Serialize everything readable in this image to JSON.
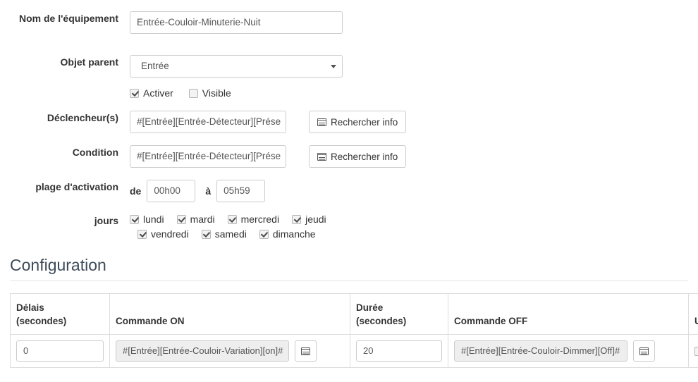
{
  "form": {
    "rows": [
      {
        "label": "Nom de l'équipement",
        "type": "text",
        "value": "Entrée-Couloir-Minuterie-Nuit"
      },
      {
        "label": "Objet parent",
        "type": "select",
        "value": "Entrée"
      },
      {
        "label": "Déclencheur(s)",
        "type": "expr",
        "value": "#[Entrée][Entrée-Détecteur][Prése"
      },
      {
        "label": "Condition",
        "type": "expr",
        "value": "#[Entrée][Entrée-Détecteur][Prése"
      },
      {
        "label": "plage d'activation",
        "type": "range"
      },
      {
        "label": "jours",
        "type": "days"
      }
    ],
    "name_label": "Nom de l'équipement",
    "name_value": "Entrée-Couloir-Minuterie-Nuit",
    "parent_label": "Objet parent",
    "parent_value": "Entrée",
    "trigger_label": "Déclencheur(s)",
    "trigger_value": "#[Entrée][Entrée-Détecteur][Prése",
    "condition_label": "Condition",
    "condition_value": "#[Entrée][Entrée-Détecteur][Prése",
    "search_info_label": "Rechercher info",
    "toggles": [
      {
        "label": "Activer",
        "checked": true
      },
      {
        "label": "Visible",
        "checked": false
      }
    ],
    "activer_label": "Activer",
    "visible_label": "Visible",
    "range_label": "plage d'activation",
    "range_from_prefix": "de",
    "range_from_value": "00h00",
    "range_to_prefix": "à",
    "range_to_value": "05h59",
    "days_label": "jours",
    "days": [
      {
        "label": "lundi",
        "checked": true
      },
      {
        "label": "mardi",
        "checked": true
      },
      {
        "label": "mercredi",
        "checked": true
      },
      {
        "label": "jeudi",
        "checked": true
      },
      {
        "label": "vendredi",
        "checked": true
      },
      {
        "label": "samedi",
        "checked": true
      },
      {
        "label": "dimanche",
        "checked": true
      }
    ],
    "days_row1": [
      "lundi",
      "mardi",
      "mercredi",
      "jeudi"
    ],
    "days_row2": [
      "vendredi",
      "samedi",
      "dimanche"
    ]
  },
  "configuration": {
    "title": "Configuration",
    "columns": [
      "Délais (secondes)",
      "Commande ON",
      "Durée (secondes)",
      "Commande OFF",
      "Unique"
    ],
    "col_delai_line1": "Délais",
    "col_delai_line2": "(secondes)",
    "col_on": "Commande ON",
    "col_duree_line1": "Durée",
    "col_duree_line2": "(secondes)",
    "col_off": "Commande OFF",
    "col_unique": "Unique",
    "rows": [
      {
        "delai": "0",
        "commande_on": "#[Entrée][Entrée-Couloir-Variation][on]#",
        "duree": "20",
        "commande_off": "#[Entrée][Entrée-Couloir-Dimmer][Off]#",
        "unique": false
      }
    ]
  },
  "icons": {
    "search_info": "list-icon",
    "select_caret": "chevron-down-icon",
    "expression_picker": "list-icon"
  },
  "colors": {
    "text": "#333333",
    "muted": "#555555",
    "border": "#cccccc",
    "table_border": "#dddddd",
    "heading": "#3d4c5a",
    "field_disabled_bg": "#eeeeee"
  }
}
